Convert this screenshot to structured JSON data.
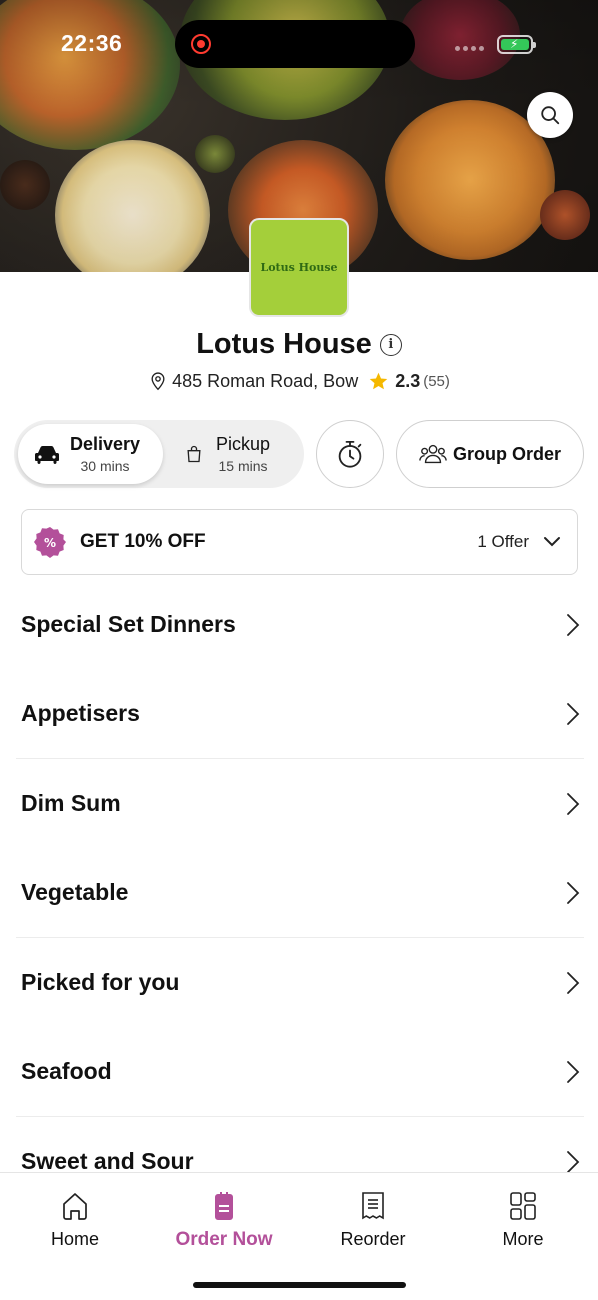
{
  "status_bar": {
    "time": "22:36"
  },
  "restaurant": {
    "logo_text": "Lotus House",
    "name": "Lotus House",
    "address": "485 Roman Road, Bow",
    "rating": "2.3",
    "rating_count": "(55)"
  },
  "mode": {
    "delivery": {
      "label": "Delivery",
      "time": "30 mins",
      "selected": true
    },
    "pickup": {
      "label": "Pickup",
      "time": "15 mins",
      "selected": false
    }
  },
  "group_order_label": "Group Order",
  "offer": {
    "title": "GET 10% OFF",
    "count": "1 Offer"
  },
  "categories": [
    "Special Set Dinners",
    "Appetisers",
    "Dim Sum",
    "Vegetable",
    "Picked for you",
    "Seafood",
    "Sweet and Sour"
  ],
  "nav": {
    "home": "Home",
    "order_now": "Order Now",
    "reorder": "Reorder",
    "more": "More",
    "active": "order_now"
  },
  "colors": {
    "accent": "#b3509a",
    "star": "#f5b800",
    "logo_bg": "#a4cf3a",
    "battery": "#34c759"
  },
  "icons": [
    "search-icon",
    "info-icon",
    "location-pin-icon",
    "star-icon",
    "car-icon",
    "bag-icon",
    "timer-icon",
    "group-icon",
    "discount-badge-icon",
    "chevron-down-icon",
    "chevron-right-icon",
    "home-icon",
    "order-icon",
    "receipt-icon",
    "grid-icon"
  ]
}
